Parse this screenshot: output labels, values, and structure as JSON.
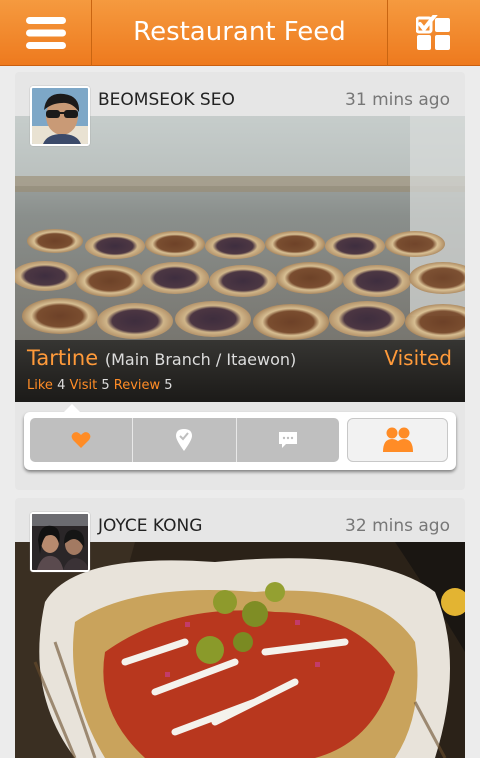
{
  "header": {
    "title": "Restaurant Feed",
    "menu_icon": "hamburger-menu-icon",
    "checklist_icon": "checklist-grid-icon"
  },
  "feed": [
    {
      "user": "BEOMSEOK SEO",
      "time": "31 mins ago",
      "restaurant": "Tartine",
      "branch": "(Main Branch / Itaewon)",
      "status": "Visited",
      "stats": {
        "like_label": "Like",
        "like_count": "4",
        "visit_label": "Visit",
        "visit_count": "5",
        "review_label": "Review",
        "review_count": "5"
      }
    },
    {
      "user": "JOYCE KONG",
      "time": "32 mins ago"
    }
  ],
  "actions": [
    "heart-icon",
    "location-check-icon",
    "comment-icon",
    "friends-icon"
  ],
  "colors": {
    "accent": "#ff8c26",
    "header": "#f08426"
  }
}
